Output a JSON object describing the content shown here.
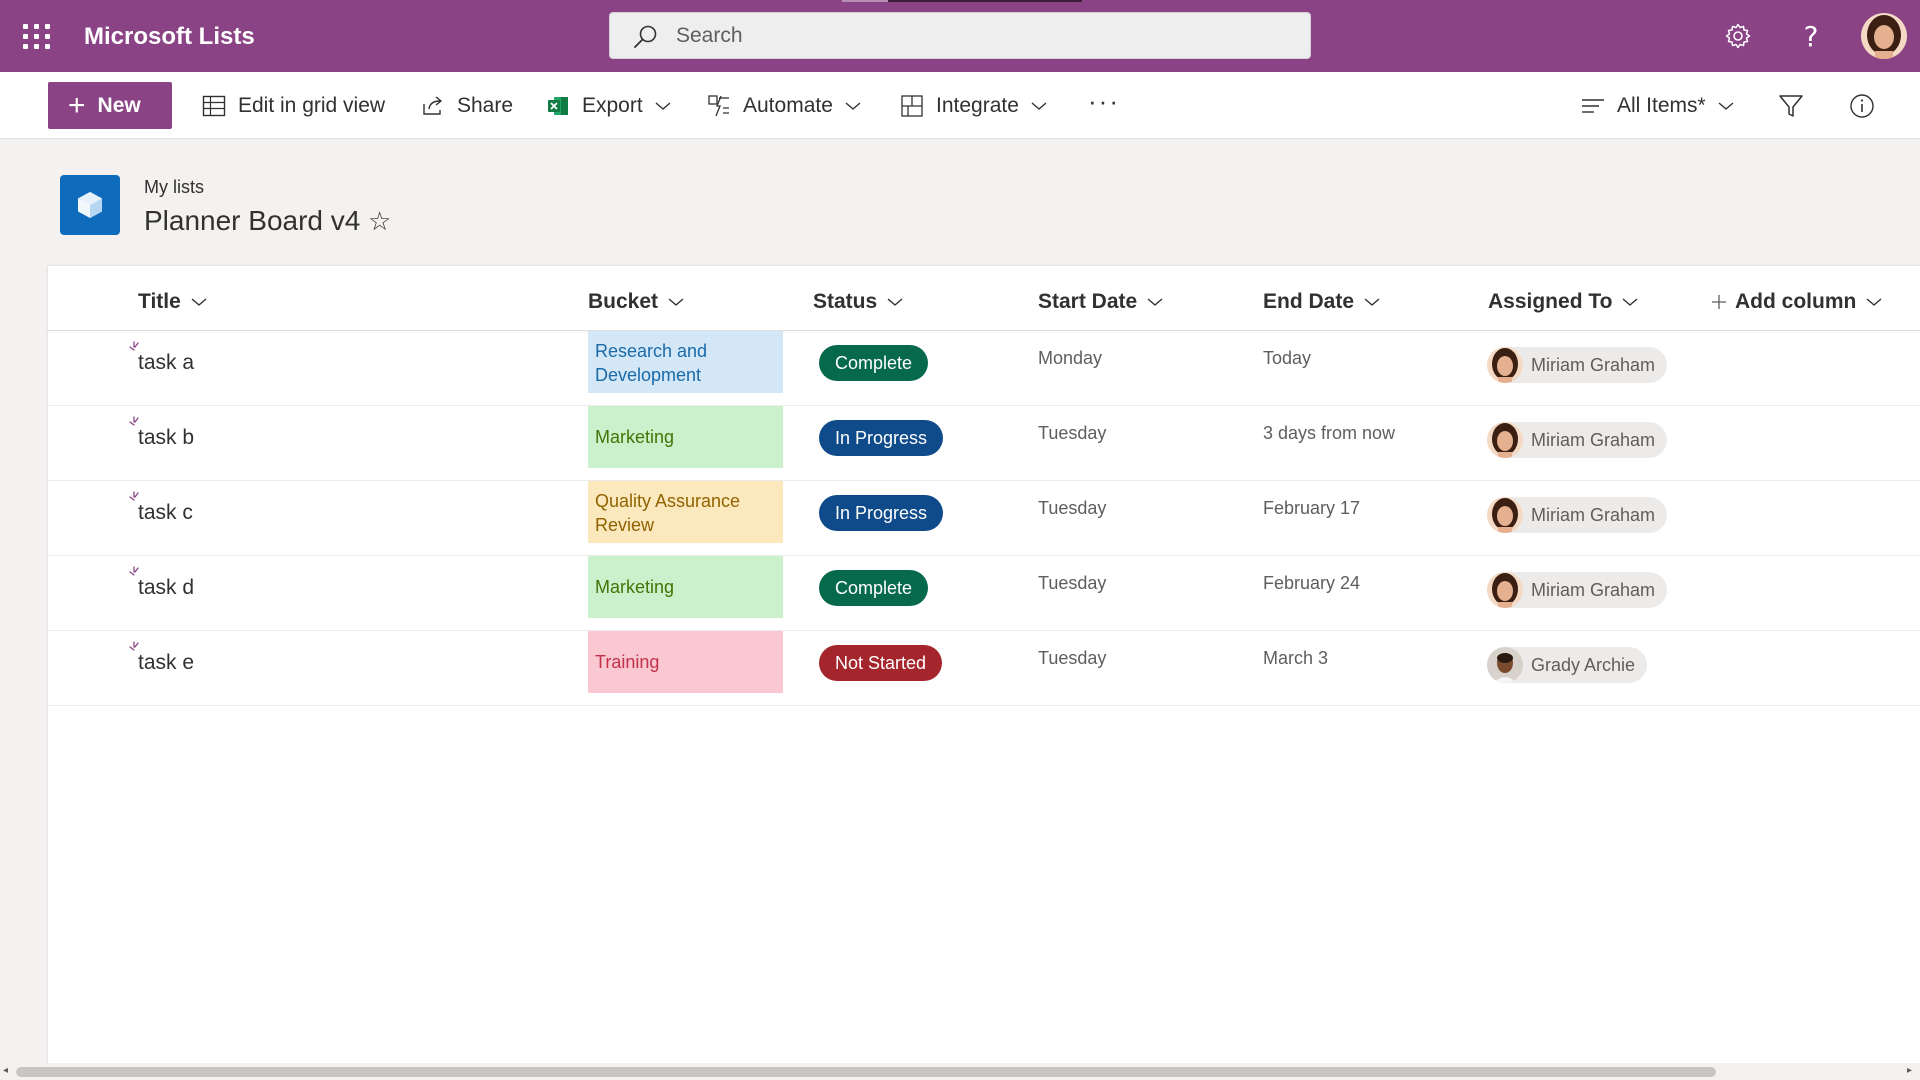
{
  "suitebar": {
    "app_title": "Microsoft Lists",
    "search_placeholder": "Search",
    "icons": [
      "waffle-icon",
      "search-icon",
      "gear-icon",
      "help-icon",
      "avatar"
    ],
    "help_glyph": "?",
    "color": "#8a4384"
  },
  "commandbar": {
    "new_label": "New",
    "edit_grid_label": "Edit in grid view",
    "share_label": "Share",
    "export_label": "Export",
    "automate_label": "Automate",
    "integrate_label": "Integrate",
    "more_label": "···",
    "view_label": "All Items*"
  },
  "header": {
    "breadcrumb": "My lists",
    "title": "Planner Board v4",
    "star": "☆"
  },
  "columns": {
    "title": "Title",
    "bucket": "Bucket",
    "status": "Status",
    "start_date": "Start Date",
    "end_date": "End Date",
    "assigned_to": "Assigned To",
    "add_column": "Add column"
  },
  "rows": [
    {
      "title": "task a",
      "bucket": "Research and Development",
      "status": "Complete",
      "start": "Monday",
      "end": "Today",
      "assigned": "Miriam Graham"
    },
    {
      "title": "task b",
      "bucket": "Marketing",
      "status": "In Progress",
      "start": "Tuesday",
      "end": "3 days from now",
      "assigned": "Miriam Graham"
    },
    {
      "title": "task c",
      "bucket": "Quality Assurance Review",
      "status": "In Progress",
      "start": "Tuesday",
      "end": "February 17",
      "assigned": "Miriam Graham"
    },
    {
      "title": "task d",
      "bucket": "Marketing",
      "status": "Complete",
      "start": "Tuesday",
      "end": "February 24",
      "assigned": "Miriam Graham"
    },
    {
      "title": "task e",
      "bucket": "Training",
      "status": "Not Started",
      "start": "Tuesday",
      "end": "March 3",
      "assigned": "Grady Archie"
    }
  ],
  "colors": {
    "bucket_research": {
      "bg": "#d3e7f7",
      "fg": "#1a6aa8"
    },
    "bucket_marketing": {
      "bg": "#caf0cc",
      "fg": "#437406"
    },
    "bucket_qa": {
      "bg": "#fce8bd",
      "fg": "#8f6300"
    },
    "bucket_training": {
      "bg": "#fac8d0",
      "fg": "#c4314b"
    },
    "status_complete": "#06694b",
    "status_in_progress": "#0f4a8a",
    "status_not_started": "#a4262c"
  }
}
